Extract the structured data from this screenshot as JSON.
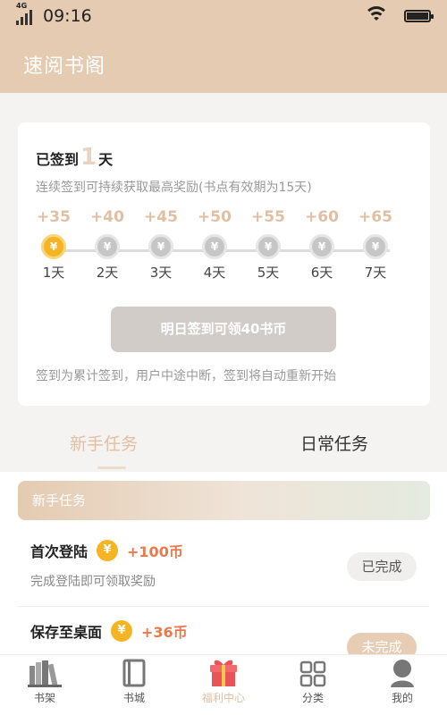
{
  "status_bar": {
    "network": "4G",
    "time": "09:16"
  },
  "app": {
    "title": "速阅书阁"
  },
  "signin": {
    "prefix": "已签到",
    "count": "1",
    "suffix": "天",
    "description": "连续签到可持续获取最高奖励(书点有效期为15天)",
    "coin_symbol": "¥",
    "days": [
      {
        "points": "+35",
        "label": "1天",
        "signed": true
      },
      {
        "points": "+40",
        "label": "2天",
        "signed": false
      },
      {
        "points": "+45",
        "label": "3天",
        "signed": false
      },
      {
        "points": "+50",
        "label": "4天",
        "signed": false
      },
      {
        "points": "+55",
        "label": "5天",
        "signed": false
      },
      {
        "points": "+60",
        "label": "6天",
        "signed": false
      },
      {
        "points": "+65",
        "label": "7天",
        "signed": false
      }
    ],
    "button_label": "明日签到可领40书币",
    "note": "签到为累计签到，用户中途中断，签到将自动重新开始"
  },
  "task_tabs": [
    {
      "label": "新手任务",
      "active": true
    },
    {
      "label": "日常任务",
      "active": false
    }
  ],
  "tasks_section": {
    "header": "新手任务",
    "items": [
      {
        "name": "首次登陆",
        "coin": "¥",
        "reward": "+100币",
        "description": "完成登陆即可领取奖励",
        "status": "已完成"
      },
      {
        "name": "保存至桌面",
        "coin": "¥",
        "reward": "+36币",
        "description": "",
        "status": "未完成"
      }
    ]
  },
  "bottom_nav": [
    {
      "label": "书架",
      "icon": "bookshelf-icon",
      "active": false
    },
    {
      "label": "书城",
      "icon": "book-icon",
      "active": false
    },
    {
      "label": "福利中心",
      "icon": "gift-icon",
      "active": true
    },
    {
      "label": "分类",
      "icon": "grid-icon",
      "active": false
    },
    {
      "label": "我的",
      "icon": "user-icon",
      "active": false
    }
  ],
  "colors": {
    "header_bg": "#e4cbb2",
    "accent": "#e1bfa1",
    "coin_gold": "#f5b423",
    "reward_orange": "#e87a4b",
    "gift_red": "#e8545a"
  }
}
